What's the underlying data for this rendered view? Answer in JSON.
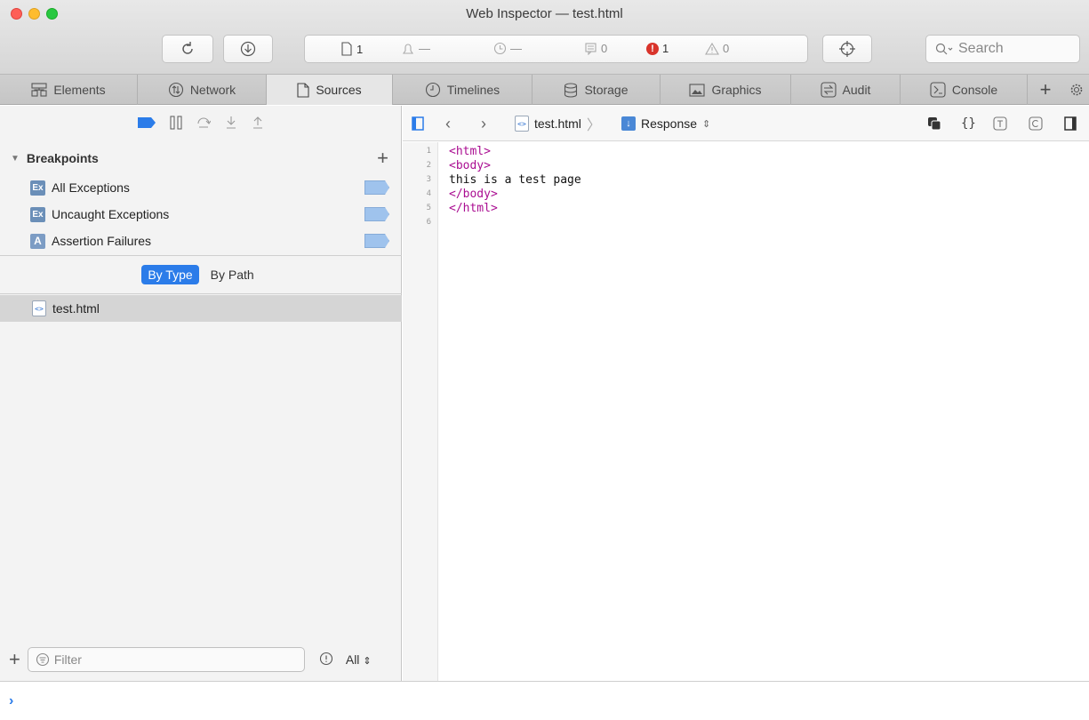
{
  "window": {
    "title": "Web Inspector — test.html"
  },
  "toolbar": {
    "resources_count": "1",
    "network_activity": "—",
    "load_time": "—",
    "logs_count": "0",
    "errors_count": "1",
    "warnings_count": "0",
    "search_placeholder": "Search"
  },
  "tabs": [
    {
      "label": "Elements",
      "icon": "elements-icon"
    },
    {
      "label": "Network",
      "icon": "network-icon"
    },
    {
      "label": "Sources",
      "icon": "sources-icon",
      "selected": true
    },
    {
      "label": "Timelines",
      "icon": "timelines-icon"
    },
    {
      "label": "Storage",
      "icon": "storage-icon"
    },
    {
      "label": "Graphics",
      "icon": "graphics-icon"
    },
    {
      "label": "Audit",
      "icon": "audit-icon"
    },
    {
      "label": "Console",
      "icon": "console-icon"
    }
  ],
  "sidebar": {
    "breakpoints_title": "Breakpoints",
    "breakpoints": [
      {
        "icon_text": "Ex",
        "label": "All Exceptions"
      },
      {
        "icon_text": "Ex",
        "label": "Uncaught Exceptions"
      },
      {
        "icon_text": "A",
        "label": "Assertion Failures"
      }
    ],
    "scope_by_type": "By Type",
    "scope_by_path": "By Path",
    "file": "test.html",
    "filter_placeholder": "Filter",
    "filter_select": "All"
  },
  "editor": {
    "file": "test.html",
    "response": "Response",
    "lines": [
      {
        "no": "1",
        "text": "<html>",
        "kind": "tag"
      },
      {
        "no": "2",
        "text": "<body>",
        "kind": "tag"
      },
      {
        "no": "3",
        "text": "this is a test page",
        "kind": "txt"
      },
      {
        "no": "4",
        "text": "</body>",
        "kind": "tag"
      },
      {
        "no": "5",
        "text": "</html>",
        "kind": "tag"
      },
      {
        "no": "6",
        "text": "",
        "kind": "txt"
      }
    ]
  },
  "colors": {
    "accent": "#2b7ce9",
    "tag": "#aa0d91",
    "error": "#d9342b"
  }
}
